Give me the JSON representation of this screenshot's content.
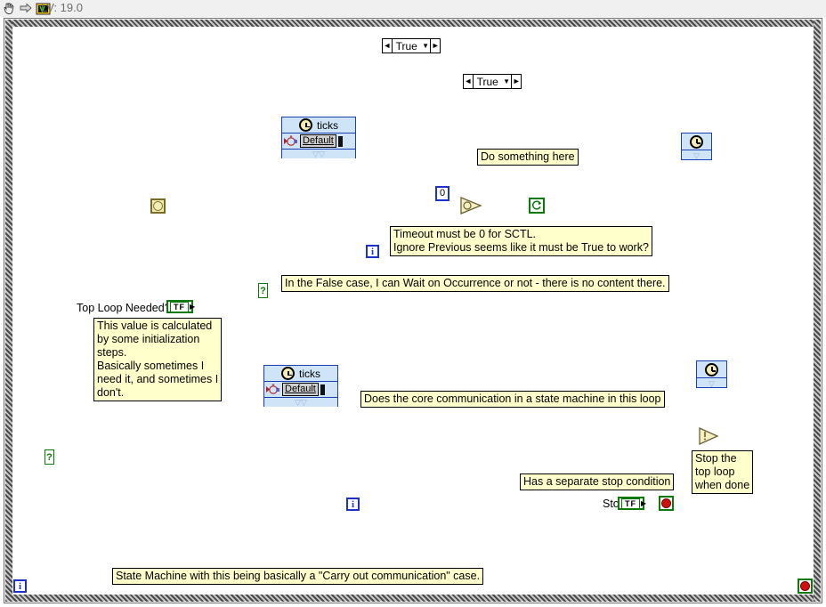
{
  "toolbar": {
    "icons": [
      "hand-cursor-icon",
      "arrow-right-icon",
      "labview-icon"
    ],
    "version_label": "LV: 19.0"
  },
  "diagram": {
    "outer_case": {
      "selector_label": "True",
      "left_arrow": "◄",
      "right_arrow": "►",
      "caret": "▼",
      "selector_terminal": "?"
    },
    "inner_case": {
      "selector_label": "True",
      "left_arrow": "◄",
      "right_arrow": "►",
      "caret": "▼",
      "selector_terminal": "?"
    },
    "top_timed_loop": {
      "config": {
        "source_label": "ticks",
        "period_value": "Default",
        "clock_icon": "clock-icon",
        "chevron": "⌄"
      },
      "right_node": {
        "clock_icon": "clock-icon",
        "chevron": "⌄"
      },
      "iteration_terminal": "i",
      "comments": {
        "do_something": "Do something here",
        "timeout_note": "Timeout must be 0 for SCTL.\nIgnore Previous seems like it must be True to work?"
      },
      "zero_constant": "0",
      "wait_occurrence_icon": "wait-on-occurrence-icon"
    },
    "bottom_timed_loop": {
      "config": {
        "source_label": "ticks",
        "period_value": "Default",
        "clock_icon": "clock-icon",
        "chevron": "⌄"
      },
      "right_node": {
        "clock_icon": "clock-icon",
        "chevron": "⌄"
      },
      "iteration_terminal": "i",
      "comments": {
        "core_comm": "Does the core communication in a state machine in this loop",
        "stop_condition": "Has a separate stop condition"
      },
      "stop_label": "Stop",
      "stop_control_value": "TF",
      "stop_button_icon": "stop-button-icon"
    },
    "top_loop_needed": {
      "label": "Top Loop Needed?",
      "control_value": "TF",
      "comment": "This value is calculated\nby some initialization\nsteps.\nBasically sometimes I\nneed it, and sometimes I\ndon't."
    },
    "false_case_comment": "In the False case, I can Wait on Occurrence or not - there is no content there.",
    "set_occurrence": {
      "icon": "set-occurrence-icon",
      "comment": "Stop the\ntop loop\nwhen done"
    },
    "occurrence_constant_icon": "occurrence-refnum-constant-icon",
    "bottom_comment": "State Machine with this being basically a \"Carry out communication\" case.",
    "bottom_iteration_terminal": "i",
    "bottom_stop_button_icon": "stop-button-icon"
  },
  "colors": {
    "wire_teal": "#0a6b64",
    "wire_green_dotted": "#118a11",
    "structure_blue": "#1a3fb0",
    "comment_yellow": "#ffffcc",
    "config_panel_blue": "#cfe4f7",
    "loop_grey": "#9d9d9d"
  }
}
